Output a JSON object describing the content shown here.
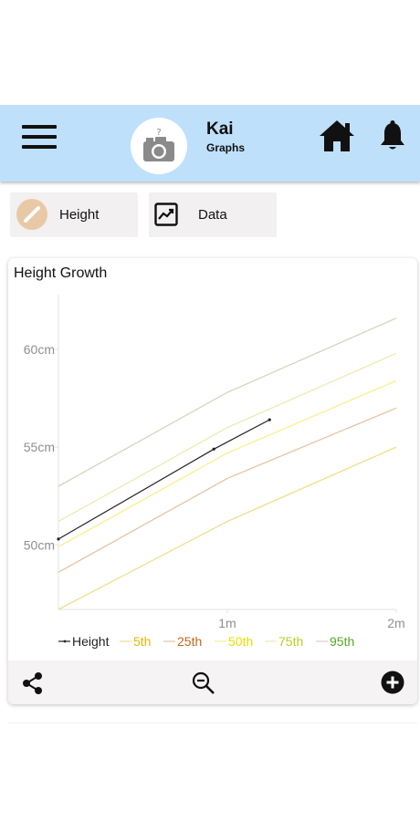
{
  "header": {
    "name": "Kai",
    "subtitle": "Graphs",
    "menu_icon": "hamburger-menu-icon",
    "avatar_icon": "camera-question-icon",
    "home_icon": "home-icon",
    "bell_icon": "bell-icon",
    "background": "#bfe0fb"
  },
  "tabs": [
    {
      "label": "Height",
      "icon": "pencil-icon"
    },
    {
      "label": "Data",
      "icon": "trend-chart-icon"
    }
  ],
  "chart_card": {
    "title": "Height Growth",
    "footer_icons": [
      "share-icon",
      "zoom-out-icon",
      "add-circle-icon"
    ]
  },
  "chart_data": {
    "type": "line",
    "title": "Height Growth",
    "xlabel": "",
    "ylabel": "",
    "x_ticks": [
      "1m",
      "2m"
    ],
    "y_ticks": [
      "50cm",
      "55cm",
      "60cm"
    ],
    "ylim": [
      46.7,
      62.8
    ],
    "xlim": [
      0,
      2
    ],
    "grid": false,
    "legend_position": "bottom",
    "series": [
      {
        "name": "Height",
        "color": "#222222",
        "x": [
          0,
          0.92,
          1.25
        ],
        "y": [
          50.3,
          54.9,
          56.4
        ]
      },
      {
        "name": "5th",
        "color": "#f0df8a",
        "x": [
          0,
          1,
          2
        ],
        "y": [
          46.7,
          51.2,
          55.0
        ]
      },
      {
        "name": "25th",
        "color": "#e6c3a3",
        "x": [
          0,
          1,
          2
        ],
        "y": [
          48.6,
          53.4,
          57.0
        ]
      },
      {
        "name": "50th",
        "color": "#f6f08c",
        "x": [
          0,
          1,
          2
        ],
        "y": [
          49.9,
          54.7,
          58.4
        ]
      },
      {
        "name": "75th",
        "color": "#eeeab0",
        "x": [
          0,
          1,
          2
        ],
        "y": [
          51.2,
          56.0,
          59.8
        ]
      },
      {
        "name": "95th",
        "color": "#d9d2c2",
        "x": [
          0,
          1,
          2
        ],
        "y": [
          53.0,
          57.8,
          61.6
        ]
      }
    ],
    "legend_label_colors": {
      "Height": "#222222",
      "5th": "#e0b800",
      "25th": "#c8651e",
      "50th": "#e6e000",
      "75th": "#b8cc22",
      "95th": "#55a823"
    }
  }
}
